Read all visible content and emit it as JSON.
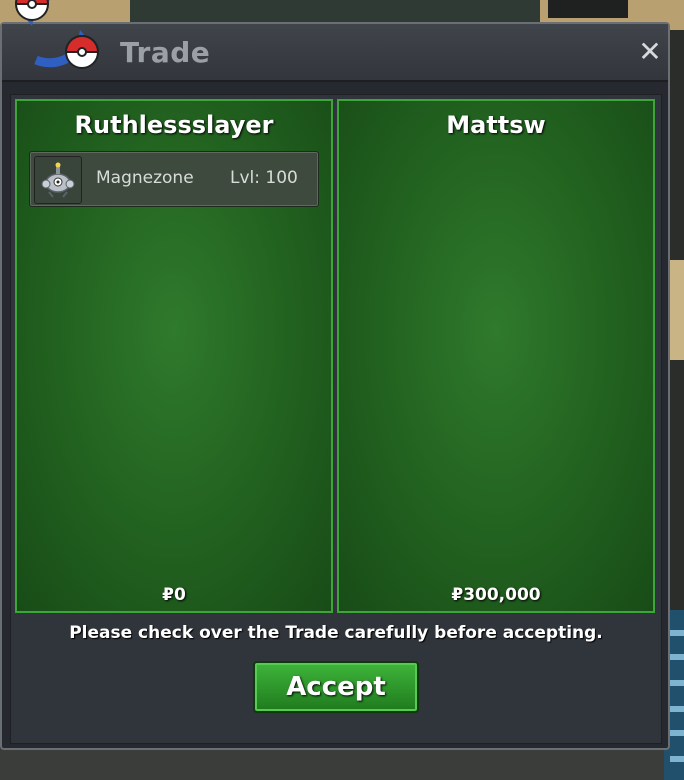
{
  "window": {
    "title": "Trade",
    "close_icon": "close-icon"
  },
  "trade": {
    "left": {
      "player": "Ruthlessslayer",
      "items": [
        {
          "name": "Magnezone",
          "level": "Lvl: 100",
          "icon": "magnezone-sprite-icon"
        }
      ],
      "money": "₽0"
    },
    "right": {
      "player": "Mattsw",
      "items": [],
      "money": "₽300,000"
    }
  },
  "footer": {
    "notice": "Please check over the Trade carefully before accepting.",
    "accept_label": "Accept"
  },
  "colors": {
    "panel_green": "#1f5c1d",
    "panel_border": "#3da53a",
    "accept_green": "#2f9a2c",
    "window_bg": "#262a30"
  }
}
